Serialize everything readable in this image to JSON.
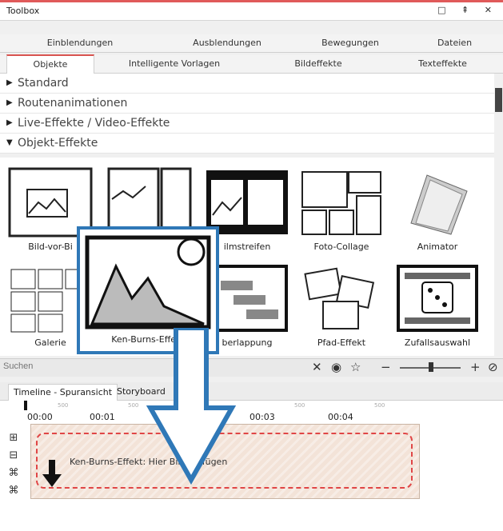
{
  "window": {
    "title": "Toolbox",
    "controls": "□ ⇞ ✕"
  },
  "tabs_row1": [
    "Einblendungen",
    "Ausblendungen",
    "Bewegungen",
    "Dateien"
  ],
  "tabs_row2": [
    "Objekte",
    "Intelligente Vorlagen",
    "Bildeffekte",
    "Texteffekte"
  ],
  "categories": [
    "Standard",
    "Routenanimationen",
    "Live-Effekte / Video-Effekte",
    "Objekt-Effekte"
  ],
  "tiles": [
    "Bild-vor-Bi",
    "",
    "ilmstreifen",
    "Foto-Collage",
    "Animator",
    "Galerie",
    "berlappung",
    "Pfad-Effekt",
    "Zufallsauswahl"
  ],
  "highlight_label": "Ken-Burns-Effekt",
  "search": {
    "placeholder": "Suchen"
  },
  "timeline": {
    "tabs": [
      "Timeline - Spuransicht",
      "Storyboard"
    ],
    "ticks": [
      "00:00",
      "00:01",
      "00:03",
      "00:04"
    ],
    "minor": [
      "500",
      "500",
      "500",
      "500"
    ],
    "clip_text": "Ken-Burns-Effekt: Hier Bild einfügen"
  },
  "colors": {
    "accent": "#d9534f",
    "highlight": "#2f78b7",
    "clip": "#f3e3d8"
  }
}
